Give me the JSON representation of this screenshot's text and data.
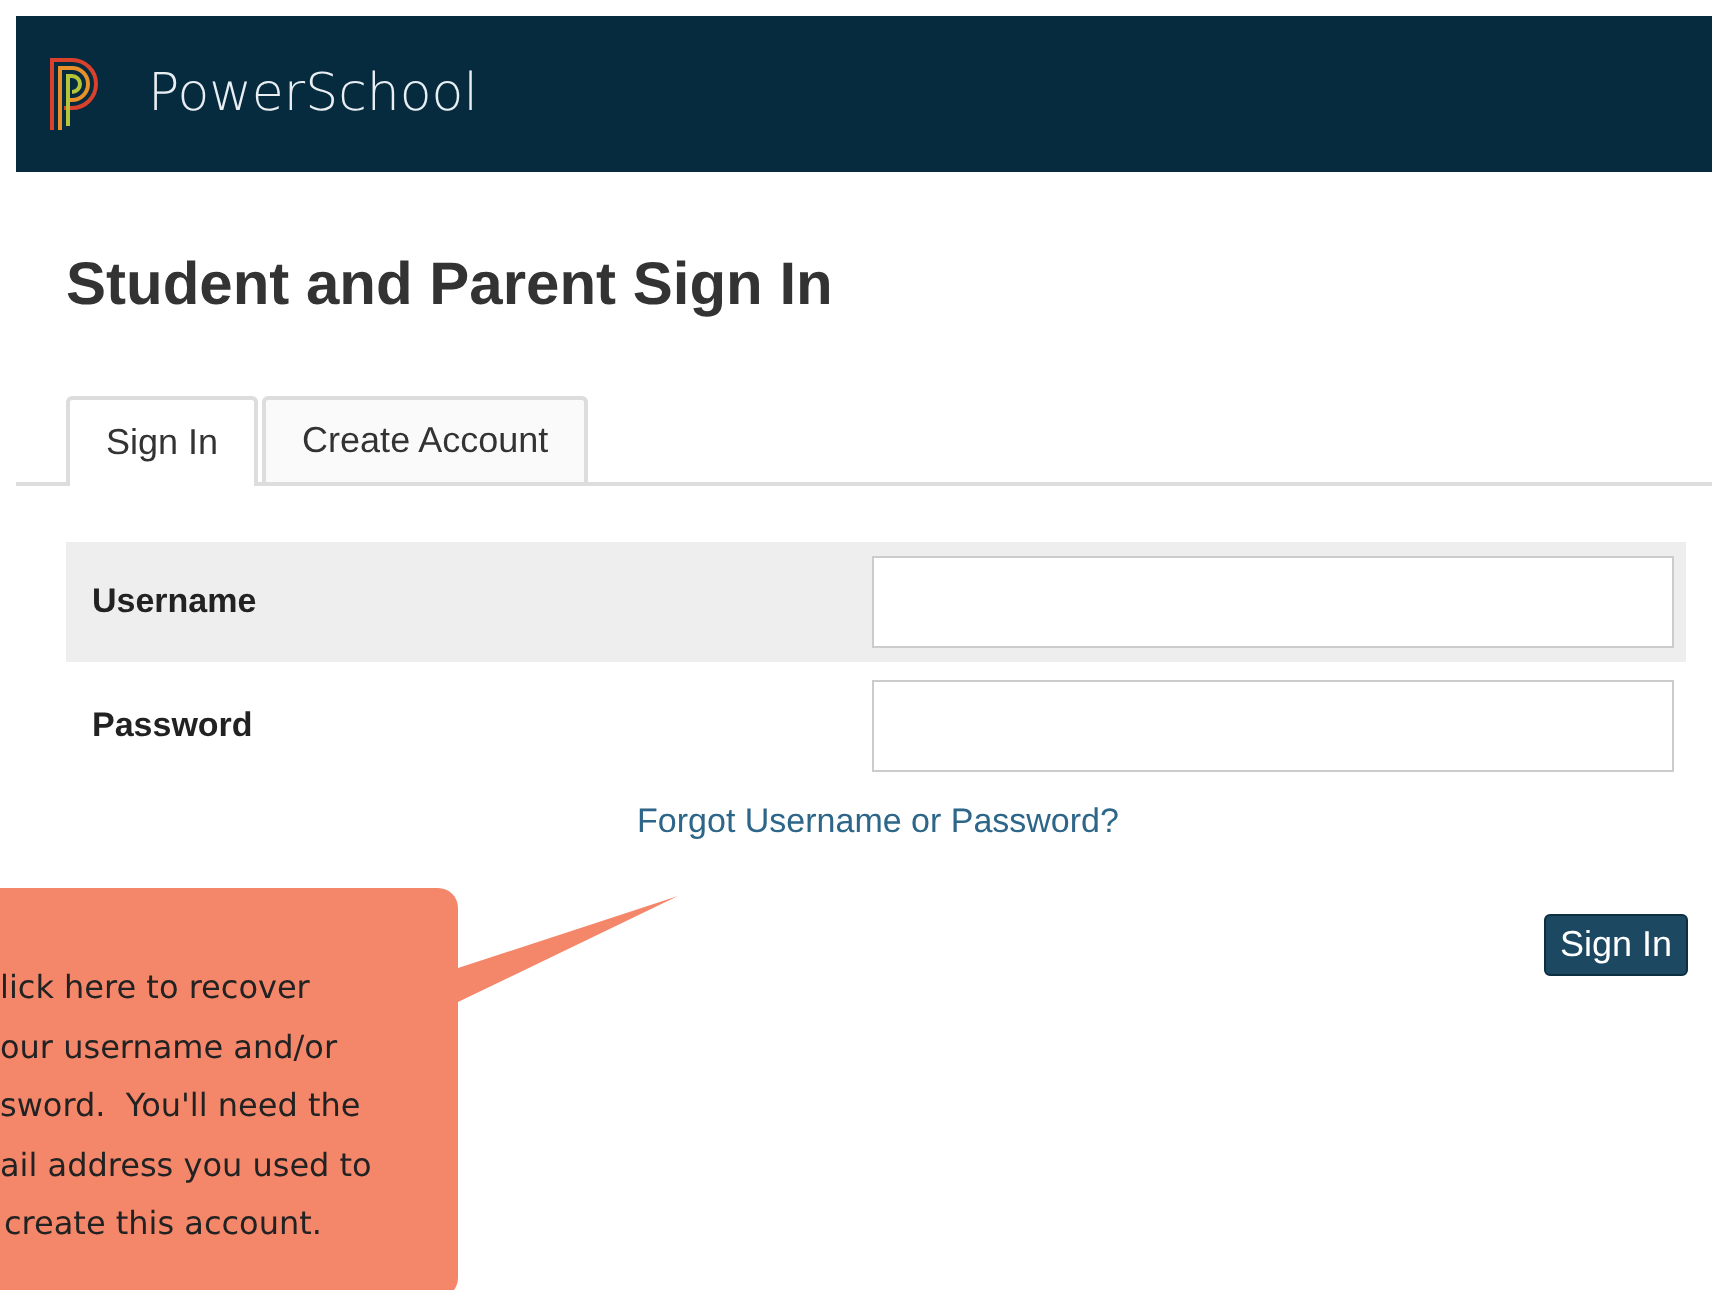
{
  "header": {
    "brand": "PowerSchool"
  },
  "title": "Student and Parent Sign In",
  "tabs": [
    {
      "label": "Sign In",
      "selected": true
    },
    {
      "label": "Create Account",
      "selected": false
    }
  ],
  "fields": [
    {
      "label": "Username",
      "shaded": true
    },
    {
      "label": "Password",
      "shaded": false
    }
  ],
  "forgot_link": "Forgot Username or Password?",
  "submit_button": "Sign In",
  "callout": {
    "lines": [
      "lick here to recover",
      "our username and/or",
      "sword.  You'll need the",
      "ail address you used to",
      "create this account."
    ]
  }
}
